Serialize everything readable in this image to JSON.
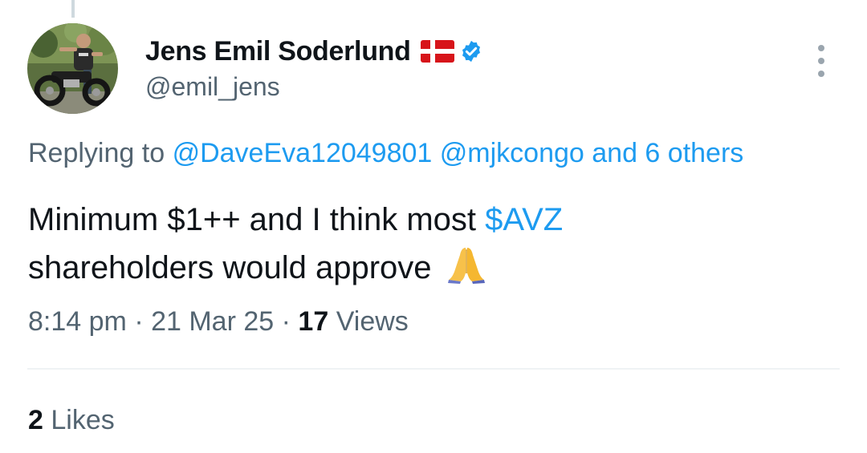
{
  "author": {
    "display_name": "Jens Emil Soderlund",
    "handle": "@emil_jens",
    "flag_icon": "denmark-flag-icon",
    "verified_icon": "verified-badge-icon"
  },
  "reply": {
    "prefix": "Replying to",
    "mention_1": "@DaveEva12049801",
    "mention_2": "@mjkcongo",
    "others": "and 6 others"
  },
  "tweet": {
    "text_part1": "Minimum $1++ and I think most ",
    "cashtag": "$AVZ",
    "text_part2": " shareholders would approve",
    "emoji_icon": "folded-hands-emoji"
  },
  "meta": {
    "time": "8:14 pm",
    "separator": "·",
    "date": "21 Mar 25",
    "views_count": "17",
    "views_label": "Views"
  },
  "stats": {
    "likes_count": "2",
    "likes_label": "Likes"
  },
  "colors": {
    "link": "#1d9bf0",
    "secondary_text": "#536471",
    "primary_text": "#0f1419",
    "divider": "#eff3f4"
  }
}
